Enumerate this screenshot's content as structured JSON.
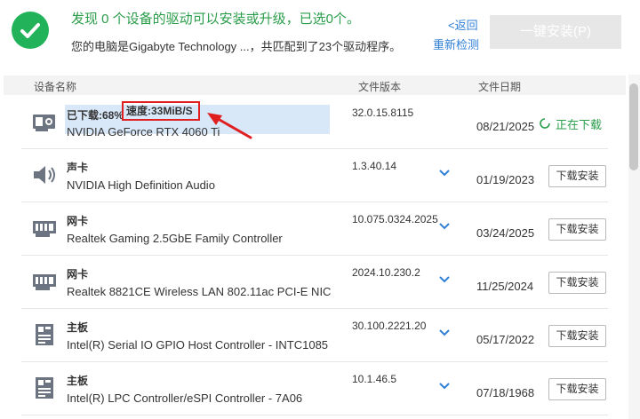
{
  "header": {
    "status_title": "发现 0 个设备的驱动可以安装或升级，已选0个。",
    "status_sub": "您的电脑是Gigabyte Technology ...，共匹配到了23个驱动程序。",
    "back_label": "<返回",
    "redetect_label": "重新检测",
    "install_all_label": "一键安装(P)"
  },
  "columns": {
    "device": "设备名称",
    "version": "文件版本",
    "date": "文件日期"
  },
  "downloading_row": {
    "progress": "已下载:68%",
    "speed": "速度:33MiB/S",
    "name": "NVIDIA GeForce RTX 4060 Ti",
    "version": "32.0.15.8115",
    "date": "08/21/2025",
    "status": "正在下载",
    "icon": "gpu-icon"
  },
  "rows": [
    {
      "type": "声卡",
      "name": "NVIDIA High Definition Audio",
      "version": "1.3.40.14",
      "date": "01/19/2023",
      "button": "下载安装",
      "icon": "speaker-icon"
    },
    {
      "type": "网卡",
      "name": "Realtek Gaming 2.5GbE Family Controller",
      "version": "10.075.0324.2025",
      "date": "03/24/2025",
      "button": "下载安装",
      "icon": "network-card-icon"
    },
    {
      "type": "网卡",
      "name": "Realtek 8821CE Wireless LAN 802.11ac PCI-E NIC",
      "version": "2024.10.230.2",
      "date": "11/25/2024",
      "button": "下载安装",
      "icon": "network-card-icon"
    },
    {
      "type": "主板",
      "name": "Intel(R) Serial IO GPIO Host Controller - INTC1085",
      "version": "30.100.2221.20",
      "date": "05/17/2022",
      "button": "下载安装",
      "icon": "motherboard-icon"
    },
    {
      "type": "主板",
      "name": "Intel(R) LPC Controller/eSPI Controller - 7A06",
      "version": "10.1.46.5",
      "date": "07/18/1968",
      "button": "下载安装",
      "icon": "motherboard-icon"
    }
  ],
  "colors": {
    "accent_green": "#21b25a",
    "link_blue": "#2f7fd6",
    "highlight_red": "#e02020"
  }
}
